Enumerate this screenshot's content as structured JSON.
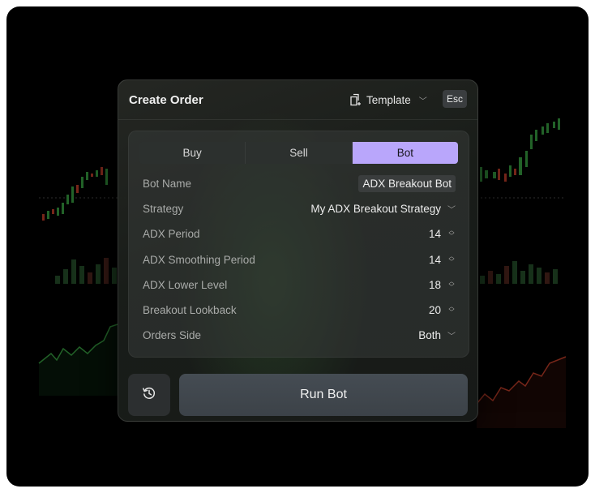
{
  "modal": {
    "title": "Create Order",
    "template_label": "Template",
    "esc_label": "Esc"
  },
  "tabs": [
    {
      "label": "Buy",
      "active": false
    },
    {
      "label": "Sell",
      "active": false
    },
    {
      "label": "Bot",
      "active": true
    }
  ],
  "form": {
    "bot_name": {
      "label": "Bot Name",
      "value": "ADX Breakout Bot"
    },
    "strategy": {
      "label": "Strategy",
      "value": "My ADX Breakout Strategy"
    },
    "adx_period": {
      "label": "ADX Period",
      "value": "14"
    },
    "adx_smoothing_period": {
      "label": "ADX Smoothing Period",
      "value": "14"
    },
    "adx_lower_level": {
      "label": "ADX Lower Level",
      "value": "18"
    },
    "breakout_lookback": {
      "label": "Breakout Lookback",
      "value": "20"
    },
    "orders_side": {
      "label": "Orders Side",
      "value": "Both"
    }
  },
  "actions": {
    "run_label": "Run Bot"
  },
  "icons": {
    "template": "template-icon",
    "history": "history-icon",
    "stepper": "stepper-icon",
    "chevron": "chevron-down-icon"
  },
  "colors": {
    "accent": "#b9a6fb",
    "background": "#000000",
    "up": "#3fb24a",
    "down": "#d9462f"
  }
}
